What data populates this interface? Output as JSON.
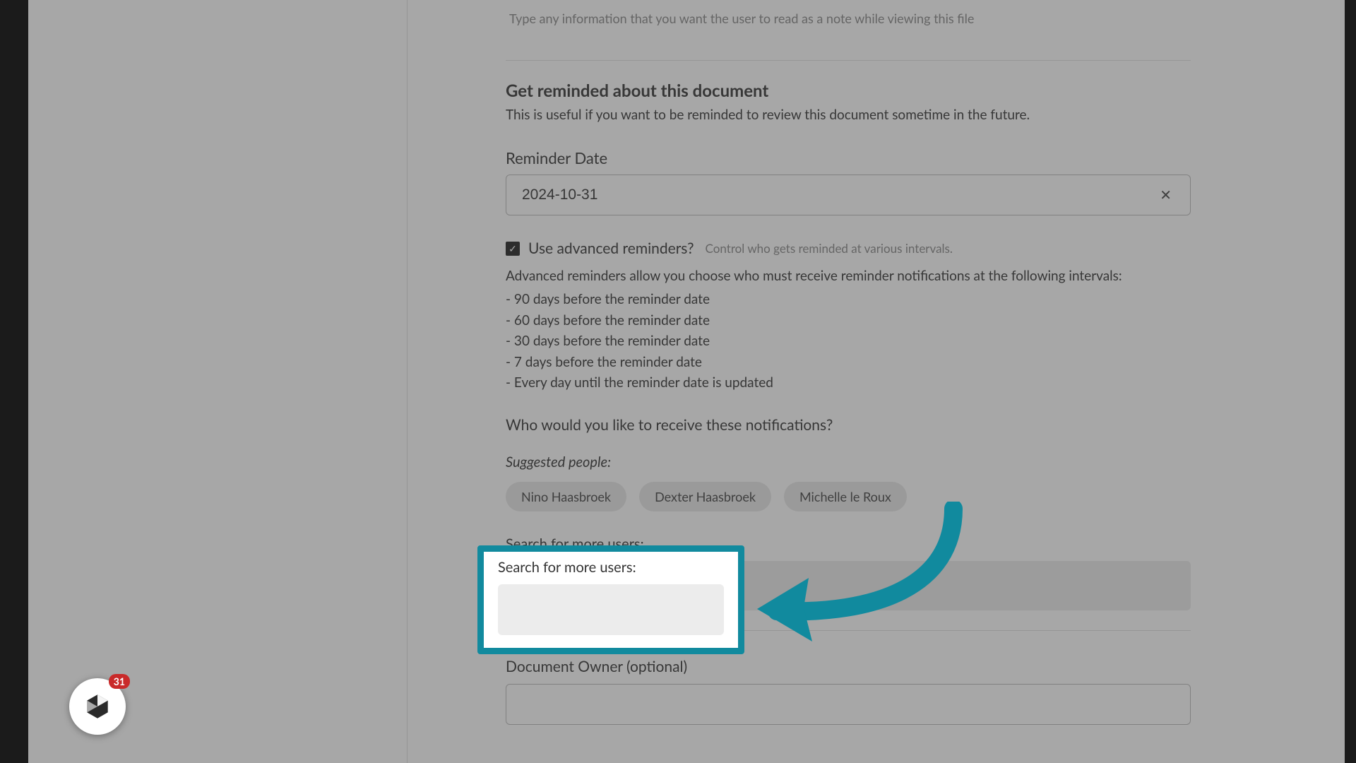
{
  "note": {
    "placeholder": "Type any information that you want the user to read as a note while viewing this file"
  },
  "reminders": {
    "heading": "Get reminded about this document",
    "subtext": "This is useful if you want to be reminded to review this document sometime in the future.",
    "date_label": "Reminder Date",
    "date_value": "2024-10-31",
    "advanced_label": "Use advanced reminders?",
    "advanced_hint": "Control who gets reminded at various intervals.",
    "advanced_intro": "Advanced reminders allow you choose who must receive reminder notifications at the following intervals:",
    "intervals": [
      "- 90 days before the reminder date",
      "- 60 days before the reminder date",
      "- 30 days before the reminder date",
      "- 7 days before the reminder date",
      "- Every day until the reminder date is updated"
    ],
    "who_label": "Who would you like to receive these notifications?",
    "suggested_label": "Suggested people:",
    "suggestions": [
      "Nino Haasbroek",
      "Dexter Haasbroek",
      "Michelle le Roux"
    ],
    "search_label": "Search for more users:"
  },
  "owner": {
    "label": "Document Owner (optional)",
    "value": ""
  },
  "widget": {
    "badge": "31"
  },
  "colors": {
    "accent": "#118a9e",
    "chip_bg": "#e7e7e7",
    "badge": "#c92a2a"
  }
}
